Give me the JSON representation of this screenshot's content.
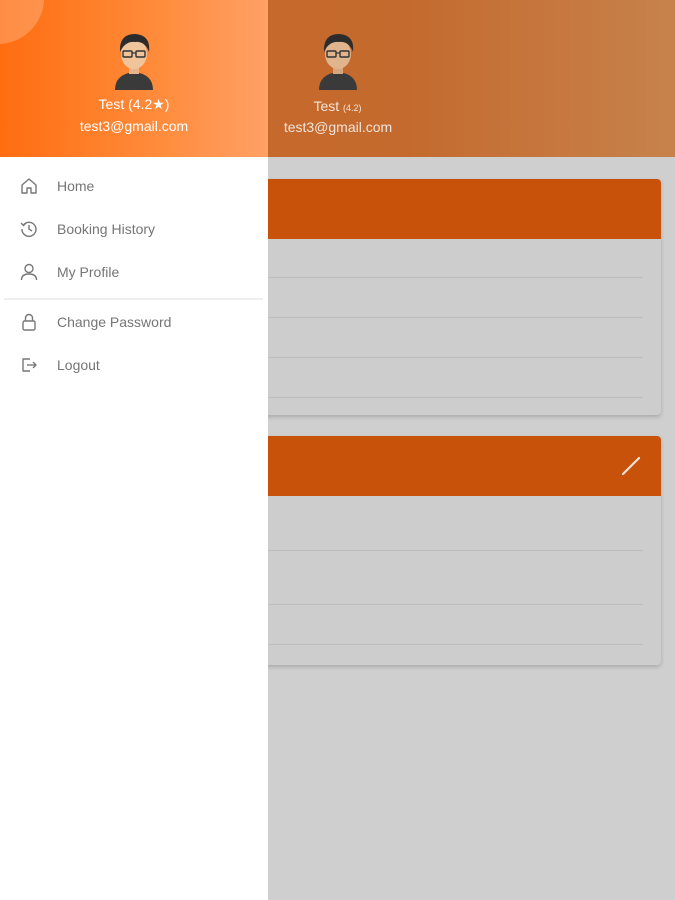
{
  "user": {
    "name_rating": "Test (4.2★)",
    "name": "Test",
    "rating_small": "(4.2)",
    "email": "test3@gmail.com"
  },
  "drawer": {
    "items": [
      {
        "label": "Home",
        "icon": "home-icon"
      },
      {
        "label": "Booking History",
        "icon": "history-icon"
      },
      {
        "label": "My Profile",
        "icon": "user-icon"
      },
      {
        "label": "Change Password",
        "icon": "lock-icon"
      },
      {
        "label": "Logout",
        "icon": "logout-icon"
      }
    ]
  },
  "colors": {
    "drawer_header_start": "#ff6d10",
    "drawer_header_end": "#ffa066",
    "card_header": "#c8520a",
    "overlay_background": "#cfcfcf",
    "menu_text": "#757575"
  }
}
